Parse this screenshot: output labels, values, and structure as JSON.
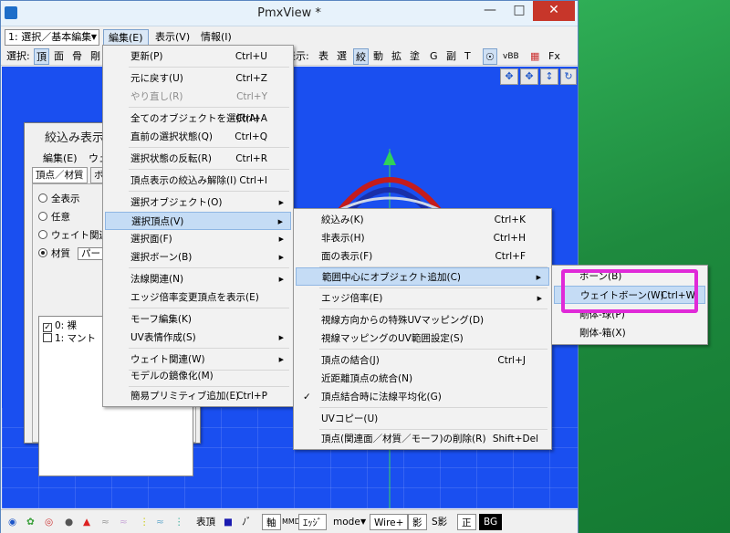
{
  "window": {
    "title": "PmxView *"
  },
  "menubar": {
    "mode_select": "1: 選択／基本編集",
    "menus": [
      "編集(E)",
      "表示(V)",
      "情報(I)"
    ]
  },
  "toolbar": {
    "left": [
      "選択:",
      "頂",
      "面",
      "骨",
      "剛"
    ],
    "right": [
      "表示:",
      "表",
      "選",
      "絞",
      "動",
      "拡",
      "塗",
      "G",
      "副",
      "T",
      "vBB",
      "Fx"
    ]
  },
  "panel": {
    "title": "絞込み表示",
    "menus": [
      "編集(E)",
      "ウェ"
    ],
    "tabs": [
      "頂点／材質",
      "ボ"
    ],
    "radios": [
      "全表示",
      "任意",
      "ウェイト関連",
      "材質"
    ],
    "material_value": "パー",
    "items": [
      "0: 裸",
      "1: マント"
    ]
  },
  "edit_menu": {
    "items": [
      {
        "label": "更新(P)",
        "shortcut": "Ctrl+U"
      },
      {
        "label": "元に戻す(U)",
        "shortcut": "Ctrl+Z"
      },
      {
        "label": "やり直し(R)",
        "shortcut": "Ctrl+Y"
      },
      {
        "label": "全てのオブジェクトを選択(A)",
        "shortcut": "Ctrl+A"
      },
      {
        "label": "直前の選択状態(Q)",
        "shortcut": "Ctrl+Q"
      },
      {
        "label": "選択状態の反転(R)",
        "shortcut": "Ctrl+R"
      },
      {
        "label": "頂点表示の絞込み解除(I)",
        "shortcut": "Ctrl+I"
      },
      {
        "label": "選択オブジェクト(O)",
        "shortcut": ""
      },
      {
        "label": "選択頂点(V)",
        "shortcut": ""
      },
      {
        "label": "選択面(F)",
        "shortcut": ""
      },
      {
        "label": "選択ボーン(B)",
        "shortcut": ""
      },
      {
        "label": "法線関連(N)",
        "shortcut": ""
      },
      {
        "label": "エッジ倍率変更頂点を表示(E)",
        "shortcut": ""
      },
      {
        "label": "モーフ編集(K)",
        "shortcut": ""
      },
      {
        "label": "UV表情作成(S)",
        "shortcut": ""
      },
      {
        "label": "ウェイト関連(W)",
        "shortcut": ""
      },
      {
        "label": "モデルの鏡像化(M)",
        "shortcut": ""
      },
      {
        "label": "簡易プリミティブ追加(E)",
        "shortcut": "Ctrl+P"
      }
    ]
  },
  "vertex_menu": {
    "items": [
      {
        "label": "絞込み(K)",
        "shortcut": "Ctrl+K"
      },
      {
        "label": "非表示(H)",
        "shortcut": "Ctrl+H"
      },
      {
        "label": "面の表示(F)",
        "shortcut": "Ctrl+F"
      },
      {
        "label": "範囲中心にオブジェクト追加(C)",
        "shortcut": ""
      },
      {
        "label": "エッジ倍率(E)",
        "shortcut": ""
      },
      {
        "label": "視線方向からの特殊UVマッピング(D)",
        "shortcut": ""
      },
      {
        "label": "視線マッピングのUV範囲設定(S)",
        "shortcut": ""
      },
      {
        "label": "頂点の結合(J)",
        "shortcut": "Ctrl+J"
      },
      {
        "label": "近距離頂点の統合(N)",
        "shortcut": ""
      },
      {
        "label": "頂点結合時に法線平均化(G)",
        "shortcut": ""
      },
      {
        "label": "UVコピー(U)",
        "shortcut": ""
      },
      {
        "label": "頂点(関連面／材質／モーフ)の削除(R)",
        "shortcut": "Shift+Del"
      }
    ]
  },
  "object_menu": {
    "items": [
      {
        "label": "ボーン(B)",
        "shortcut": ""
      },
      {
        "label": "ウェイトボーン(W)",
        "shortcut": "Ctrl+W"
      },
      {
        "label": "剛体-球(P)",
        "shortcut": ""
      },
      {
        "label": "剛体-箱(X)",
        "shortcut": ""
      }
    ]
  },
  "bottombar": {
    "labels": [
      "表頂",
      "ﾉﾞ",
      "軸",
      "ｴｯｼﾞ",
      "mode",
      "Wire+",
      "影",
      "S影",
      "正",
      "BG"
    ]
  }
}
